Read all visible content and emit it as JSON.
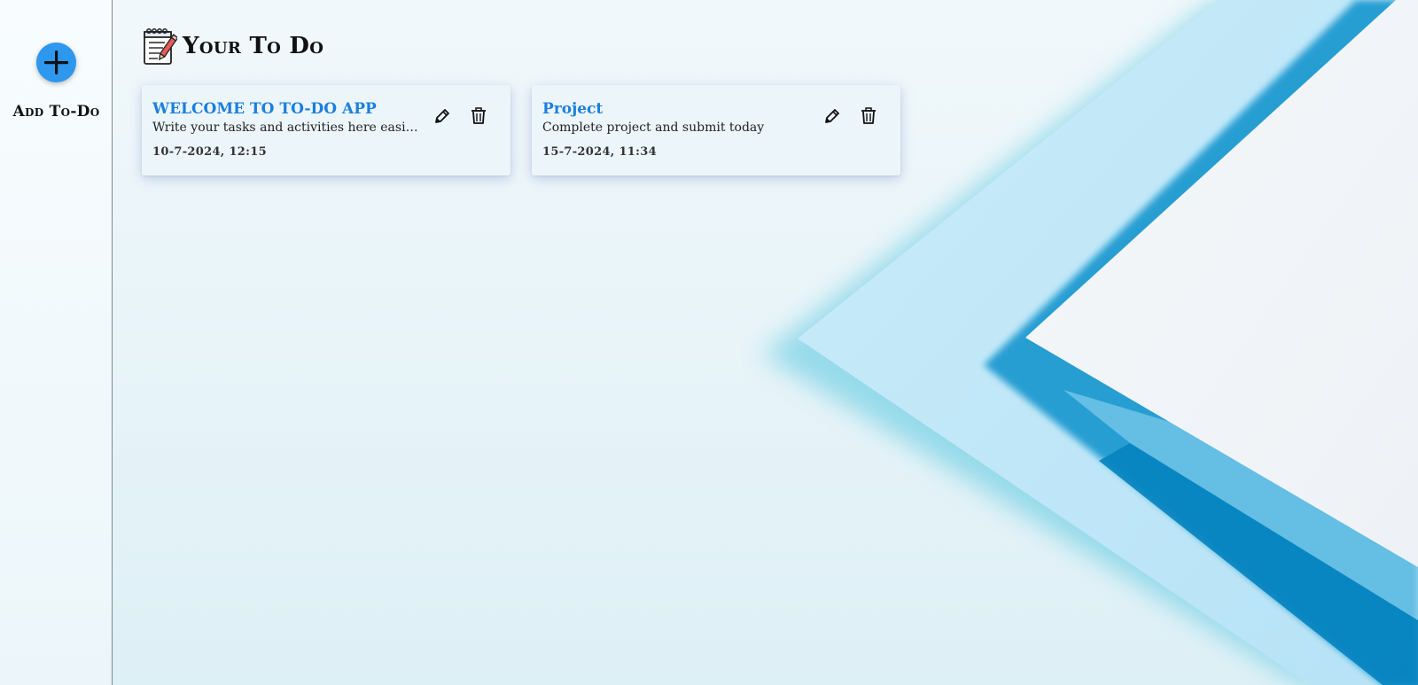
{
  "sidebar": {
    "add_label": "Add To-Do",
    "add_icon": "plus-icon",
    "add_button_color": "#2e97ee"
  },
  "header": {
    "title": "Your To Do",
    "icon": "notepad-pencil-icon"
  },
  "todos": [
    {
      "title": "WELCOME TO TO-DO APP",
      "description": "Write your tasks and activities here easily...",
      "date": "10-7-2024, 12:15"
    },
    {
      "title": "Project",
      "description": "Complete project and submit today",
      "date": "15-7-2024, 11:34"
    }
  ],
  "icons": {
    "edit": "pencil-icon",
    "delete": "trash-icon"
  },
  "colors": {
    "title_accent": "#1a7fe0",
    "background": "#e9f5f9",
    "paper_blue": "#0a92cc"
  }
}
